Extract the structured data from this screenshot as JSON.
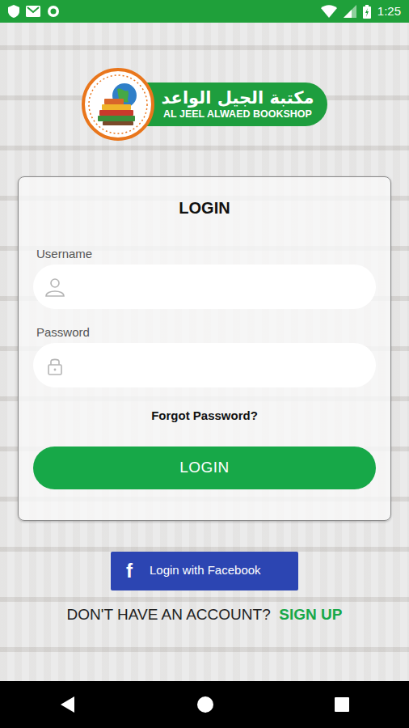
{
  "status_bar": {
    "time": "1:25"
  },
  "logo": {
    "arabic": "مكتبة الجيل الواعد",
    "english": "AL JEEL ALWAED BOOKSHOP"
  },
  "login_card": {
    "title": "LOGIN",
    "fields": [
      {
        "label": "Username",
        "kind": "text"
      },
      {
        "label": "Password",
        "kind": "password"
      }
    ],
    "forgot_link": "Forgot Password?",
    "submit_button": "LOGIN"
  },
  "facebook_button": {
    "icon": "f",
    "label": "Login with Facebook"
  },
  "signup": {
    "prompt": "DON'T HAVE AN ACCOUNT?",
    "link": "SIGN UP"
  }
}
